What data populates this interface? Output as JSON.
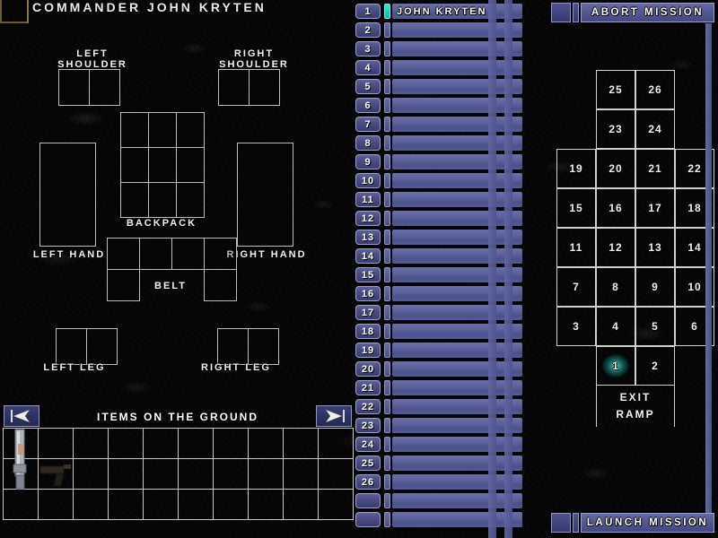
{
  "window": {
    "title": "Commander John Kryten"
  },
  "equipment": {
    "left_shoulder_label": "Left\nShoulder",
    "right_shoulder_label": "Right\nShoulder",
    "backpack_label": "Backpack",
    "left_hand_label": "Left Hand",
    "right_hand_label": "Right Hand",
    "belt_label": "Belt",
    "left_leg_label": "Left Leg",
    "right_leg_label": "Right Leg",
    "slots": {
      "left_shoulder": {
        "cols": 2,
        "rows": 1
      },
      "right_shoulder": {
        "cols": 2,
        "rows": 1
      },
      "backpack": {
        "cols": 3,
        "rows": 3
      },
      "left_hand": {
        "cols": 1,
        "rows": 1
      },
      "right_hand": {
        "cols": 1,
        "rows": 1
      },
      "belt": {
        "cols": 4,
        "rows": 2
      },
      "left_leg": {
        "cols": 2,
        "rows": 1
      },
      "right_leg": {
        "cols": 2,
        "rows": 1
      }
    }
  },
  "ground": {
    "title": "Items on the ground",
    "prev_icon": "arrow-left-icon",
    "next_icon": "arrow-right-icon",
    "cols": 10,
    "rows": 3,
    "items": [
      {
        "name": "rifle",
        "col": 0,
        "row": 0,
        "span_rows": 2
      },
      {
        "name": "pistol",
        "col": 1,
        "row": 1,
        "span_rows": 1
      }
    ]
  },
  "roster": {
    "rows": [
      {
        "num": "1",
        "name": "John Kryten",
        "alive": true
      },
      {
        "num": "2",
        "name": "",
        "alive": false
      },
      {
        "num": "3",
        "name": "",
        "alive": false
      },
      {
        "num": "4",
        "name": "",
        "alive": false
      },
      {
        "num": "5",
        "name": "",
        "alive": false
      },
      {
        "num": "6",
        "name": "",
        "alive": false
      },
      {
        "num": "7",
        "name": "",
        "alive": false
      },
      {
        "num": "8",
        "name": "",
        "alive": false
      },
      {
        "num": "9",
        "name": "",
        "alive": false
      },
      {
        "num": "10",
        "name": "",
        "alive": false
      },
      {
        "num": "11",
        "name": "",
        "alive": false
      },
      {
        "num": "12",
        "name": "",
        "alive": false
      },
      {
        "num": "13",
        "name": "",
        "alive": false
      },
      {
        "num": "14",
        "name": "",
        "alive": false
      },
      {
        "num": "15",
        "name": "",
        "alive": false
      },
      {
        "num": "16",
        "name": "",
        "alive": false
      },
      {
        "num": "17",
        "name": "",
        "alive": false
      },
      {
        "num": "18",
        "name": "",
        "alive": false
      },
      {
        "num": "19",
        "name": "",
        "alive": false
      },
      {
        "num": "20",
        "name": "",
        "alive": false
      },
      {
        "num": "21",
        "name": "",
        "alive": false
      },
      {
        "num": "22",
        "name": "",
        "alive": false
      },
      {
        "num": "23",
        "name": "",
        "alive": false
      },
      {
        "num": "24",
        "name": "",
        "alive": false
      },
      {
        "num": "25",
        "name": "",
        "alive": false
      },
      {
        "num": "26",
        "name": "",
        "alive": false
      },
      {
        "num": "",
        "name": "",
        "alive": false
      },
      {
        "num": "",
        "name": "",
        "alive": false
      }
    ]
  },
  "mission": {
    "abort_label": "Abort Mission",
    "launch_label": "Launch Mission",
    "exit_ramp_label_line1": "Exit",
    "exit_ramp_label_line2": "Ramp",
    "deployment_rows": [
      {
        "start_col": 1,
        "cells": [
          "25",
          "26"
        ]
      },
      {
        "start_col": 1,
        "cells": [
          "23",
          "24"
        ]
      },
      {
        "start_col": 0,
        "cells": [
          "19",
          "20",
          "21",
          "22"
        ]
      },
      {
        "start_col": 0,
        "cells": [
          "15",
          "16",
          "17",
          "18"
        ]
      },
      {
        "start_col": 0,
        "cells": [
          "11",
          "12",
          "13",
          "14"
        ]
      },
      {
        "start_col": 0,
        "cells": [
          "7",
          "8",
          "9",
          "10"
        ]
      },
      {
        "start_col": 0,
        "cells": [
          "3",
          "4",
          "5",
          "6"
        ]
      },
      {
        "start_col": 1,
        "cells": [
          "1",
          "2"
        ]
      }
    ],
    "selected_cell": "1"
  },
  "colors": {
    "accent_blue": "#5b6199",
    "accent_teal": "#2ee0c8",
    "frame_gold": "#8d7740",
    "grid_line": "#cfcfd8"
  }
}
